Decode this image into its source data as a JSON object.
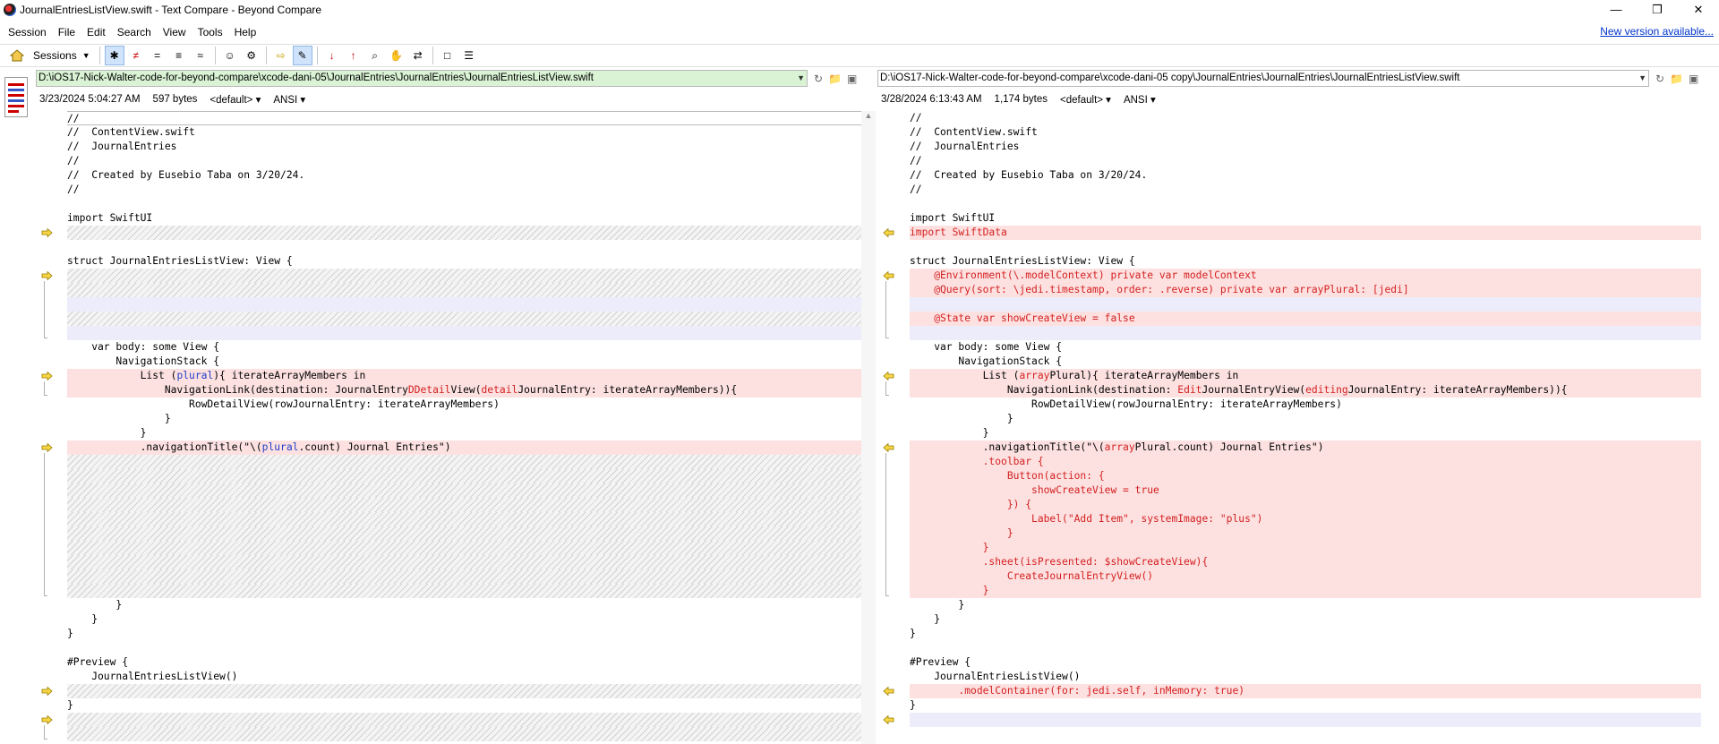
{
  "window": {
    "title": "JournalEntriesListView.swift - Text Compare - Beyond Compare",
    "controls": [
      "—",
      "❐",
      "✕"
    ]
  },
  "menu": {
    "items": [
      "Session",
      "File",
      "Edit",
      "Search",
      "View",
      "Tools",
      "Help"
    ],
    "new_version_link": "New version available..."
  },
  "toolbar": {
    "home_icon": "home-icon",
    "sessions_label": "Sessions",
    "buttons": [
      {
        "icon": "show-all-icon",
        "glyph": "✱",
        "active": true
      },
      {
        "icon": "show-diffs-icon",
        "glyph": "≠",
        "active": false
      },
      {
        "icon": "show-same-icon",
        "glyph": "=",
        "active": false
      },
      {
        "icon": "context-icon",
        "glyph": "≡",
        "active": false
      },
      {
        "icon": "minor-icon",
        "glyph": "≈",
        "active": false
      },
      {
        "icon": "rules-icon",
        "glyph": "☺",
        "active": false
      },
      {
        "icon": "format-icon",
        "glyph": "⚙",
        "active": false
      },
      {
        "icon": "copy-to-right-icon",
        "glyph": "⇨",
        "active": false
      },
      {
        "icon": "edit-icon",
        "glyph": "✎",
        "active": true
      },
      {
        "icon": "next-diff-icon",
        "glyph": "↓",
        "active": false
      },
      {
        "icon": "prev-diff-icon",
        "glyph": "↑",
        "active": false
      },
      {
        "icon": "find-icon",
        "glyph": "⌕",
        "active": false
      },
      {
        "icon": "align-icon",
        "glyph": "✋",
        "active": false
      },
      {
        "icon": "swap-icon",
        "glyph": "⇄",
        "active": false
      },
      {
        "icon": "expand-icon",
        "glyph": "□",
        "active": false
      },
      {
        "icon": "lines-icon",
        "glyph": "☰",
        "active": false
      }
    ]
  },
  "left": {
    "path": "D:\\iOS17-Nick-Walter-code-for-beyond-compare\\xcode-dani-05\\JournalEntries\\JournalEntries\\JournalEntriesListView.swift",
    "timestamp": "3/23/2024 5:04:27 AM",
    "size": "597 bytes",
    "format": "<default>",
    "encoding": "ANSI"
  },
  "right": {
    "path": "D:\\iOS17-Nick-Walter-code-for-beyond-compare\\xcode-dani-05 copy\\JournalEntries\\JournalEntries\\JournalEntriesListView.swift",
    "timestamp": "3/28/2024 6:13:43 AM",
    "size": "1,174 bytes",
    "format": "<default>",
    "encoding": "ANSI"
  },
  "colors": {
    "diff_bg": "#fde1e1",
    "diff_text": "#d42020",
    "missing_hatch": "#d2d2d2",
    "placeholder_bg": "#ececfb",
    "left_path_bg": "#d9f3d4",
    "link": "#0033cc",
    "arrow": "#c7a000"
  },
  "left_lines": [
    {
      "t": "n",
      "s": [
        [
          "//",
          ""
        ]
      ],
      "cur": true
    },
    {
      "t": "n",
      "s": [
        [
          "//  ContentView.swift",
          ""
        ]
      ]
    },
    {
      "t": "n",
      "s": [
        [
          "//  JournalEntries",
          ""
        ]
      ]
    },
    {
      "t": "n",
      "s": [
        [
          "//",
          ""
        ]
      ]
    },
    {
      "t": "n",
      "s": [
        [
          "//  Created by Eusebio Taba on 3/20/24.",
          ""
        ]
      ]
    },
    {
      "t": "n",
      "s": [
        [
          "//",
          ""
        ]
      ]
    },
    {
      "t": "n",
      "s": []
    },
    {
      "t": "n",
      "s": [
        [
          "import SwiftUI",
          ""
        ]
      ]
    },
    {
      "t": "m",
      "s": []
    },
    {
      "t": "n",
      "s": []
    },
    {
      "t": "n",
      "s": [
        [
          "struct JournalEntriesListView: View {",
          ""
        ]
      ]
    },
    {
      "t": "m",
      "s": []
    },
    {
      "t": "m",
      "s": []
    },
    {
      "t": "p",
      "s": []
    },
    {
      "t": "m",
      "s": []
    },
    {
      "t": "p",
      "s": []
    },
    {
      "t": "n",
      "s": [
        [
          "    var body: some View {",
          ""
        ]
      ]
    },
    {
      "t": "n",
      "s": [
        [
          "        NavigationStack {",
          ""
        ]
      ]
    },
    {
      "t": "d",
      "s": [
        [
          "            List (",
          ""
        ],
        [
          "plural",
          "b"
        ],
        [
          "){ iterateArrayMembers in",
          ""
        ]
      ]
    },
    {
      "t": "d",
      "s": [
        [
          "                NavigationLink(destination: JournalEntry",
          ""
        ],
        [
          "DDetail",
          "r"
        ],
        [
          "View(",
          ""
        ],
        [
          "detail",
          "r"
        ],
        [
          "JournalEntry: iterateArrayMembers)){",
          ""
        ]
      ]
    },
    {
      "t": "n",
      "s": [
        [
          "                    RowDetailView(rowJournalEntry: iterateArrayMembers)",
          ""
        ]
      ]
    },
    {
      "t": "n",
      "s": [
        [
          "                }",
          ""
        ]
      ]
    },
    {
      "t": "n",
      "s": [
        [
          "            }",
          ""
        ]
      ]
    },
    {
      "t": "d",
      "s": [
        [
          "            .navigationTitle(\"\\(",
          ""
        ],
        [
          "plural",
          "b"
        ],
        [
          ".count) Journal Entries\")",
          ""
        ]
      ]
    },
    {
      "t": "m",
      "s": []
    },
    {
      "t": "m",
      "s": []
    },
    {
      "t": "m",
      "s": []
    },
    {
      "t": "m",
      "s": []
    },
    {
      "t": "m",
      "s": []
    },
    {
      "t": "m",
      "s": []
    },
    {
      "t": "m",
      "s": []
    },
    {
      "t": "m",
      "s": []
    },
    {
      "t": "m",
      "s": []
    },
    {
      "t": "m",
      "s": []
    },
    {
      "t": "n",
      "s": [
        [
          "        }",
          ""
        ]
      ]
    },
    {
      "t": "n",
      "s": [
        [
          "    }",
          ""
        ]
      ]
    },
    {
      "t": "n",
      "s": [
        [
          "}",
          ""
        ]
      ]
    },
    {
      "t": "n",
      "s": []
    },
    {
      "t": "n",
      "s": [
        [
          "#Preview {",
          ""
        ]
      ]
    },
    {
      "t": "n",
      "s": [
        [
          "    JournalEntriesListView()",
          ""
        ]
      ]
    },
    {
      "t": "m",
      "s": []
    },
    {
      "t": "n",
      "s": [
        [
          "}",
          ""
        ]
      ]
    },
    {
      "t": "m",
      "s": []
    },
    {
      "t": "m",
      "s": []
    }
  ],
  "right_lines": [
    {
      "t": "n",
      "s": [
        [
          "//",
          ""
        ]
      ]
    },
    {
      "t": "n",
      "s": [
        [
          "//  ContentView.swift",
          ""
        ]
      ]
    },
    {
      "t": "n",
      "s": [
        [
          "//  JournalEntries",
          ""
        ]
      ]
    },
    {
      "t": "n",
      "s": [
        [
          "//",
          ""
        ]
      ]
    },
    {
      "t": "n",
      "s": [
        [
          "//  Created by Eusebio Taba on 3/20/24.",
          ""
        ]
      ]
    },
    {
      "t": "n",
      "s": [
        [
          "//",
          ""
        ]
      ]
    },
    {
      "t": "n",
      "s": []
    },
    {
      "t": "n",
      "s": [
        [
          "import SwiftUI",
          ""
        ]
      ]
    },
    {
      "t": "d",
      "s": [
        [
          "import SwiftData",
          "r"
        ]
      ]
    },
    {
      "t": "n",
      "s": []
    },
    {
      "t": "n",
      "s": [
        [
          "struct JournalEntriesListView: View {",
          ""
        ]
      ]
    },
    {
      "t": "d",
      "s": [
        [
          "    @Environment(\\.modelContext) private var modelContext",
          "r"
        ]
      ]
    },
    {
      "t": "d",
      "s": [
        [
          "    @Query(sort: \\jedi.timestamp, order: .reverse) private var arrayPlural: [jedi]",
          "r"
        ]
      ]
    },
    {
      "t": "p",
      "s": []
    },
    {
      "t": "d",
      "s": [
        [
          "    @State var showCreateView = false",
          "r"
        ]
      ]
    },
    {
      "t": "p",
      "s": []
    },
    {
      "t": "n",
      "s": [
        [
          "    var body: some View {",
          ""
        ]
      ]
    },
    {
      "t": "n",
      "s": [
        [
          "        NavigationStack {",
          ""
        ]
      ]
    },
    {
      "t": "d",
      "s": [
        [
          "            List (",
          ""
        ],
        [
          "array",
          "r"
        ],
        [
          "Plural",
          ""
        ],
        [
          "){ iterateArrayMembers in",
          ""
        ]
      ]
    },
    {
      "t": "d",
      "s": [
        [
          "                NavigationLink(destination: ",
          ""
        ],
        [
          "Edit",
          "r"
        ],
        [
          "JournalEntryView(",
          ""
        ],
        [
          "editing",
          "r"
        ],
        [
          "JournalEntry: iterateArrayMembers)){",
          ""
        ]
      ]
    },
    {
      "t": "n",
      "s": [
        [
          "                    RowDetailView(rowJournalEntry: iterateArrayMembers)",
          ""
        ]
      ]
    },
    {
      "t": "n",
      "s": [
        [
          "                }",
          ""
        ]
      ]
    },
    {
      "t": "n",
      "s": [
        [
          "            }",
          ""
        ]
      ]
    },
    {
      "t": "d",
      "s": [
        [
          "            .navigationTitle(\"\\(",
          ""
        ],
        [
          "array",
          "r"
        ],
        [
          "Plural.count) Journal Entries\")",
          ""
        ]
      ]
    },
    {
      "t": "d",
      "s": [
        [
          "            .toolbar {",
          "r"
        ]
      ]
    },
    {
      "t": "d",
      "s": [
        [
          "                Button(action: {",
          "r"
        ]
      ]
    },
    {
      "t": "d",
      "s": [
        [
          "                    showCreateView = true",
          "r"
        ]
      ]
    },
    {
      "t": "d",
      "s": [
        [
          "                }) {",
          "r"
        ]
      ]
    },
    {
      "t": "d",
      "s": [
        [
          "                    Label(\"Add Item\", systemImage: \"plus\")",
          "r"
        ]
      ]
    },
    {
      "t": "d",
      "s": [
        [
          "                }",
          "r"
        ]
      ]
    },
    {
      "t": "d",
      "s": [
        [
          "            }",
          "r"
        ]
      ]
    },
    {
      "t": "d",
      "s": [
        [
          "            .sheet(isPresented: $showCreateView){",
          "r"
        ]
      ]
    },
    {
      "t": "d",
      "s": [
        [
          "                CreateJournalEntryView()",
          "r"
        ]
      ]
    },
    {
      "t": "d",
      "s": [
        [
          "            }",
          "r"
        ]
      ]
    },
    {
      "t": "n",
      "s": [
        [
          "        }",
          ""
        ]
      ]
    },
    {
      "t": "n",
      "s": [
        [
          "    }",
          ""
        ]
      ]
    },
    {
      "t": "n",
      "s": [
        [
          "}",
          ""
        ]
      ]
    },
    {
      "t": "n",
      "s": []
    },
    {
      "t": "n",
      "s": [
        [
          "#Preview {",
          ""
        ]
      ]
    },
    {
      "t": "n",
      "s": [
        [
          "    JournalEntriesListView()",
          ""
        ]
      ]
    },
    {
      "t": "d",
      "s": [
        [
          "        .modelContainer(for: jedi.self, inMemory: true)",
          "r"
        ]
      ]
    },
    {
      "t": "n",
      "s": [
        [
          "}",
          ""
        ]
      ]
    },
    {
      "t": "p",
      "s": []
    },
    {
      "t": "n",
      "s": []
    }
  ]
}
